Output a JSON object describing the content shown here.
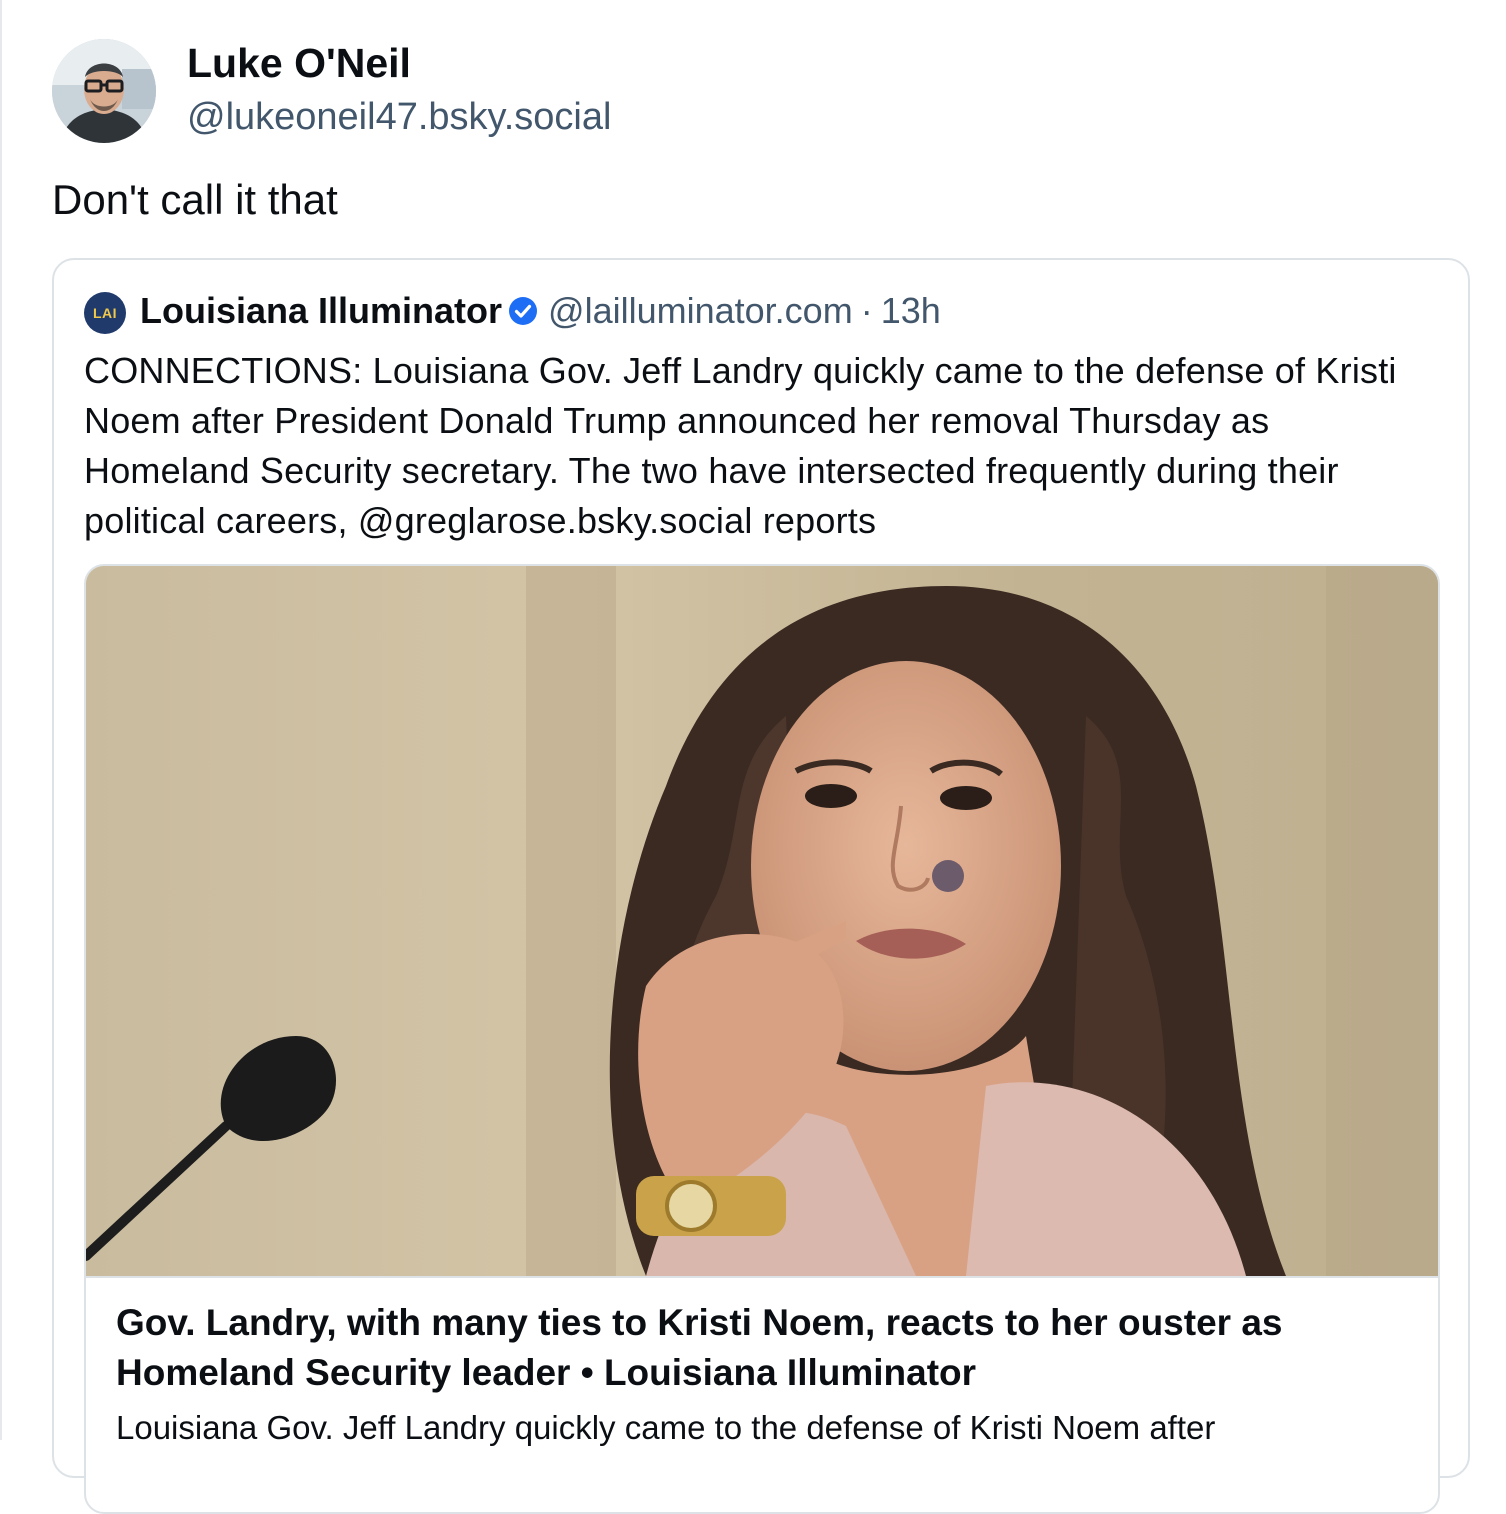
{
  "author": {
    "name": "Luke O'Neil",
    "handle": "@lukeoneil47.bsky.social",
    "avatar_icon": "user-avatar-photo"
  },
  "post": {
    "text": "Don't call it that"
  },
  "quoted_post": {
    "author_name": "Louisiana Illuminator",
    "author_avatar_text": "LAI",
    "verified": true,
    "verified_icon": "verified-check-icon",
    "handle": "@lailluminator.com",
    "separator": "·",
    "time": "13h",
    "text": "CONNECTIONS: Louisiana Gov. Jeff Landry quickly came to the defense of Kristi Noem after President Donald Trump announced her removal Thursday as Homeland Security secretary. The two have intersected frequently during their political careers, @greglarose.bsky.social reports"
  },
  "link_preview": {
    "image_icon": "article-photo",
    "title": "Gov. Landry, with many ties to Kristi Noem, reacts to her ouster as Homeland Security leader • Louisiana Illuminator",
    "description": "Louisiana Gov. Jeff Landry quickly came to the defense of Kristi Noem after"
  },
  "colors": {
    "text_primary": "#0b0f14",
    "text_secondary": "#42576c",
    "border": "#dde2e7",
    "verified_blue": "#1d6ef5"
  }
}
